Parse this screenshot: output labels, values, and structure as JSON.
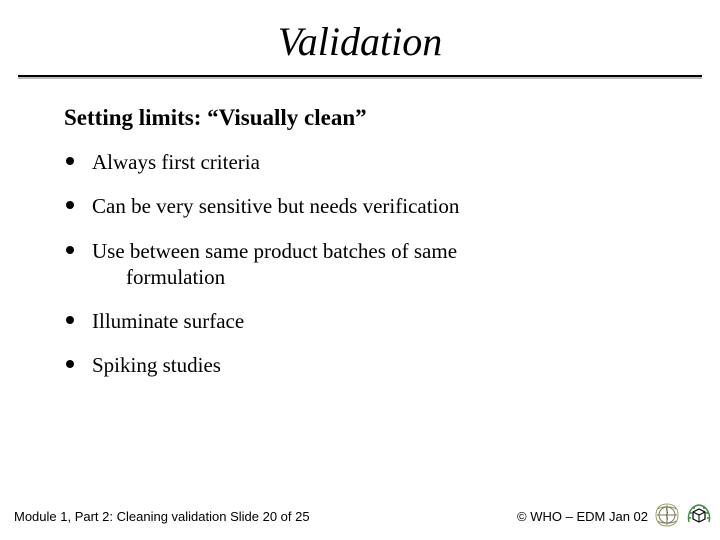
{
  "title": "Validation",
  "subtitle": "Setting limits:  “Visually clean”",
  "bullets": [
    {
      "text": "Always first criteria"
    },
    {
      "text": "Can be very sensitive but needs verification"
    },
    {
      "text_line1": "Use between same product batches of same",
      "text_line2": "formulation"
    },
    {
      "text": "Illuminate surface"
    },
    {
      "text": "Spiking studies"
    }
  ],
  "footer": {
    "left": "Module 1, Part 2: Cleaning validation  Slide 20 of 25",
    "right": "© WHO – EDM Jan 02"
  },
  "logos": {
    "who": "who-logo-icon",
    "secondary": "laurel-cube-logo-icon"
  }
}
